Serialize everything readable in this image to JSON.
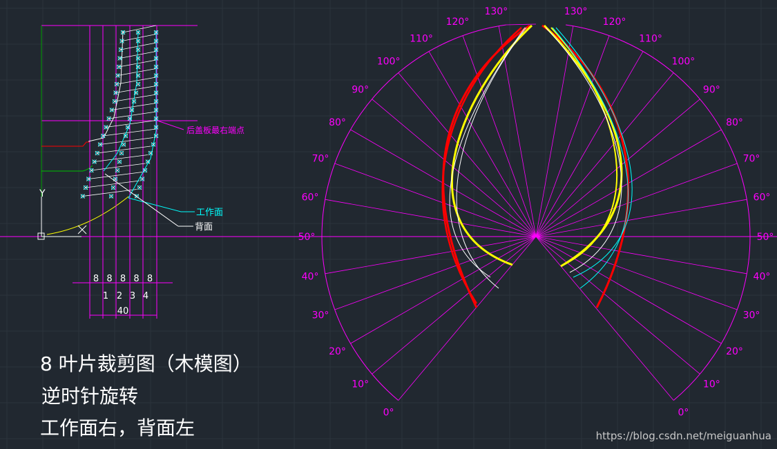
{
  "captions": {
    "title": "8 叶片裁剪图（木模图）",
    "rotation": "逆时针旋转",
    "sides": "工作面右，背面左"
  },
  "labels": {
    "rear_cover": "后盖板最右端点",
    "working_face": "工作面",
    "back_face": "背面",
    "y_axis": "Y"
  },
  "dimensions": {
    "segments": [
      "8",
      "8",
      "8",
      "8",
      "8"
    ],
    "section_numbers": [
      "1",
      "2",
      "3",
      "4"
    ],
    "total": "40"
  },
  "polar": {
    "left_angles": [
      "0°",
      "10°",
      "20°",
      "30°",
      "40°",
      "50°",
      "60°",
      "70°",
      "80°",
      "90°",
      "100°",
      "110°",
      "120°",
      "130°"
    ],
    "right_angles": [
      "0°",
      "10°",
      "20°",
      "30°",
      "40°",
      "50°",
      "60°",
      "70°",
      "80°",
      "90°",
      "100°",
      "110°",
      "120°",
      "130°"
    ]
  },
  "watermark": "https://blog.csdn.net/meiguanhua",
  "colors": {
    "background": "#212830",
    "grid": "#2c333c",
    "magenta": "#ff00ff",
    "cyan": "#00ffff",
    "yellow": "#ffff00",
    "red": "#ff0000",
    "white": "#ffffff",
    "green": "#00c000",
    "leader_red": "#ff0000"
  }
}
